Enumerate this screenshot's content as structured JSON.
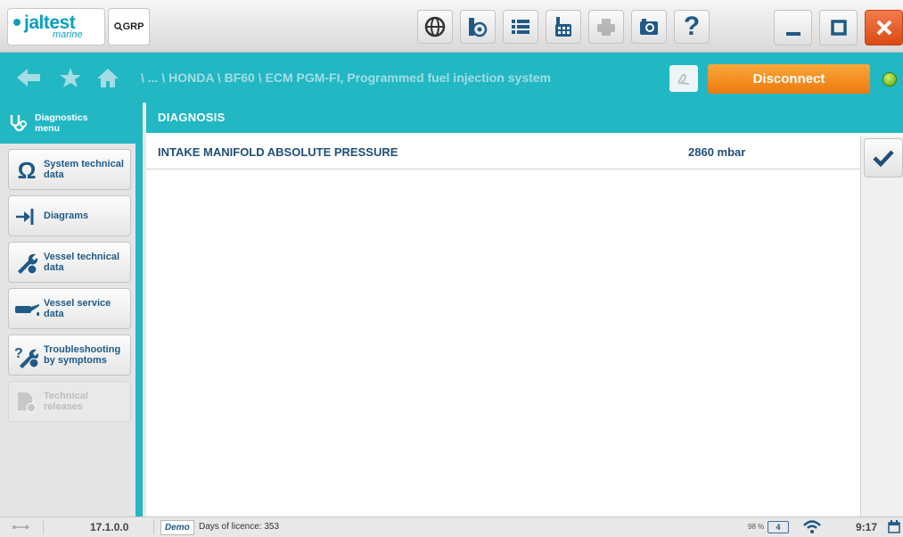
{
  "app": {
    "logo_text": "jaltest",
    "logo_sub": "marine",
    "grp_label": "GRP"
  },
  "toolbar": {
    "icons": [
      "globe-icon",
      "eye-gear-icon",
      "list-icon",
      "calculator-icon",
      "print-icon",
      "camera-icon",
      "help-icon"
    ],
    "help_glyph": "?"
  },
  "nav": {
    "breadcrumb": "\\ ... \\ HONDA \\ BF60 \\ ECM PGM-FI, Programmed fuel injection system",
    "disconnect_label": "Disconnect"
  },
  "sidebar": {
    "items": [
      {
        "label_1": "Diagnostics",
        "label_2": "menu",
        "icon": "stethoscope-icon",
        "active": true
      },
      {
        "label_1": "System technical",
        "label_2": "data",
        "icon": "omega-icon"
      },
      {
        "label_1": "Diagrams",
        "label_2": "",
        "icon": "diagram-icon"
      },
      {
        "label_1": "Vessel technical",
        "label_2": "data",
        "icon": "wrench-globe-icon"
      },
      {
        "label_1": "Vessel service",
        "label_2": "data",
        "icon": "oil-can-icon"
      },
      {
        "label_1": "Troubleshooting",
        "label_2": "by symptoms",
        "icon": "troubleshooting-icon"
      },
      {
        "label_1": "Technical",
        "label_2": "releases",
        "icon": "document-globe-icon",
        "disabled": true
      }
    ]
  },
  "main": {
    "title": "DIAGNOSIS",
    "rows": [
      {
        "name": "INTAKE MANIFOLD ABSOLUTE PRESSURE",
        "value": "2860 mbar"
      }
    ]
  },
  "status": {
    "version": "17.1.0.0",
    "demo": "Demo",
    "licence": "Days of licence: 353",
    "battery_percent": "98 %",
    "battery_glyph": "4",
    "time": "9:17"
  },
  "colors": {
    "accent": "#21b7c3",
    "disconnect": "#f2891d",
    "close": "#e05a1f",
    "text_blue": "#1f4f7a"
  }
}
